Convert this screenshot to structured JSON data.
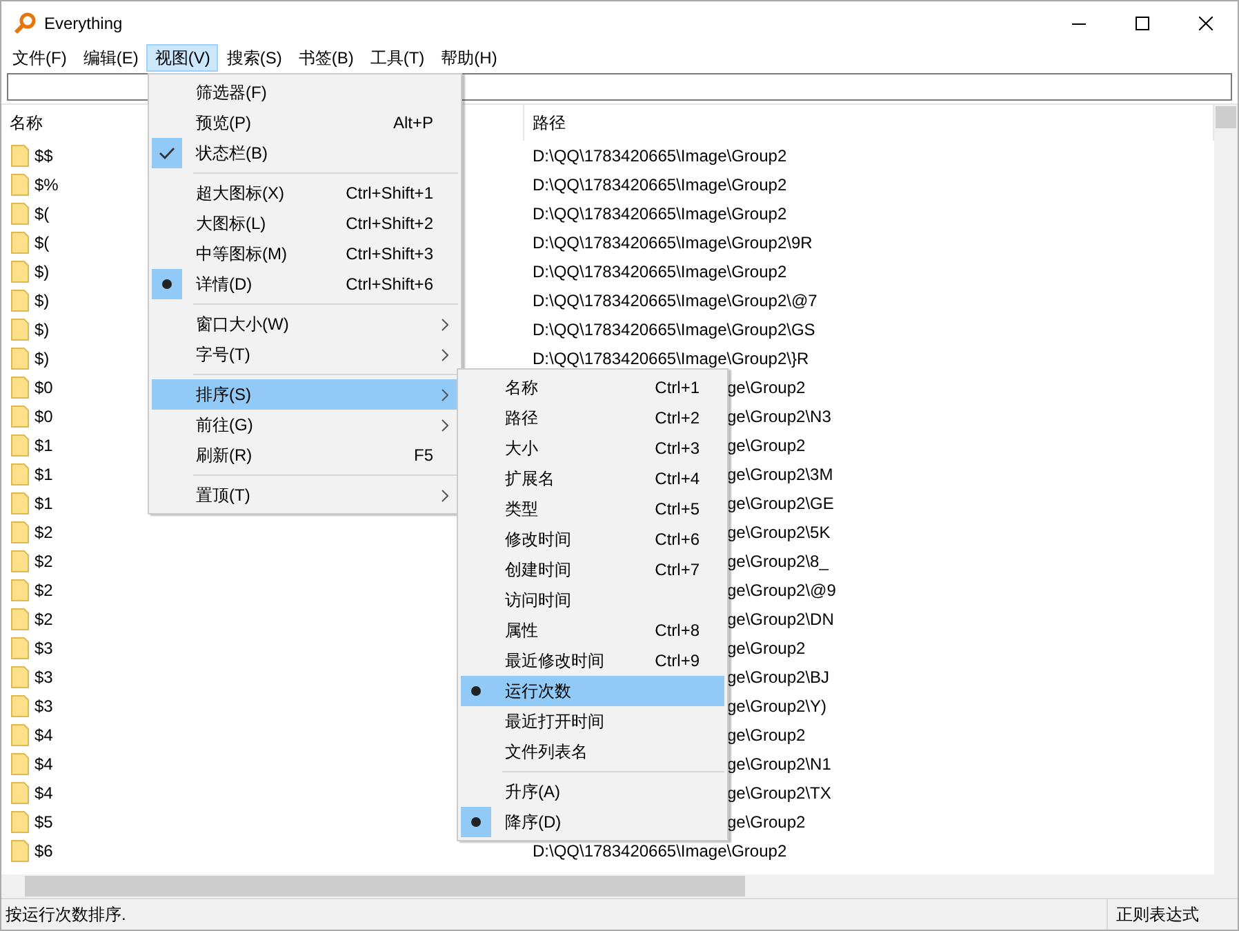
{
  "window": {
    "title": "Everything"
  },
  "menubar": [
    {
      "label": "文件(F)",
      "selected": false
    },
    {
      "label": "编辑(E)",
      "selected": false
    },
    {
      "label": "视图(V)",
      "selected": true
    },
    {
      "label": "搜索(S)",
      "selected": false
    },
    {
      "label": "书签(B)",
      "selected": false
    },
    {
      "label": "工具(T)",
      "selected": false
    },
    {
      "label": "帮助(H)",
      "selected": false
    }
  ],
  "table": {
    "columns": [
      "名称",
      "路径"
    ],
    "rows": [
      {
        "name": "$$",
        "path": "D:\\QQ\\1783420665\\Image\\Group2",
        "kind": "full"
      },
      {
        "name": "$%",
        "path": "D:\\QQ\\1783420665\\Image\\Group2",
        "kind": "full"
      },
      {
        "name": "$(",
        "path": "D:\\QQ\\1783420665\\Image\\Group2",
        "kind": "full"
      },
      {
        "name": "$(",
        "path": "D:\\QQ\\1783420665\\Image\\Group2\\9R",
        "kind": "full"
      },
      {
        "name": "$)",
        "path": "D:\\QQ\\1783420665\\Image\\Group2",
        "kind": "full"
      },
      {
        "name": "$)",
        "path": "D:\\QQ\\1783420665\\Image\\Group2\\@7",
        "kind": "full"
      },
      {
        "name": "$)",
        "path": "D:\\QQ\\1783420665\\Image\\Group2\\GS",
        "kind": "full"
      },
      {
        "name": "$)",
        "path": "D:\\QQ\\1783420665\\Image\\Group2\\}R",
        "kind": "full"
      },
      {
        "name": "$0",
        "path": "ge\\Group2",
        "kind": "clipped"
      },
      {
        "name": "$0",
        "path": "ge\\Group2\\N3",
        "kind": "clipped"
      },
      {
        "name": "$1",
        "path": "ge\\Group2",
        "kind": "clipped"
      },
      {
        "name": "$1",
        "path": "ge\\Group2\\3M",
        "kind": "clipped"
      },
      {
        "name": "$1",
        "path": "ge\\Group2\\GE",
        "kind": "clipped"
      },
      {
        "name": "$2",
        "path": "ge\\Group2\\5K",
        "kind": "clipped"
      },
      {
        "name": "$2",
        "path": "ge\\Group2\\8_",
        "kind": "clipped"
      },
      {
        "name": "$2",
        "path": "ge\\Group2\\@9",
        "kind": "clipped"
      },
      {
        "name": "$2",
        "path": "ge\\Group2\\DN",
        "kind": "clipped"
      },
      {
        "name": "$3",
        "path": "ge\\Group2",
        "kind": "clipped"
      },
      {
        "name": "$3",
        "path": "ge\\Group2\\BJ",
        "kind": "clipped"
      },
      {
        "name": "$3",
        "path": "ge\\Group2\\Y)",
        "kind": "clipped"
      },
      {
        "name": "$4",
        "path": "ge\\Group2",
        "kind": "clipped"
      },
      {
        "name": "$4",
        "path": "ge\\Group2\\N1",
        "kind": "clipped"
      },
      {
        "name": "$4",
        "path": "ge\\Group2\\TX",
        "kind": "clipped"
      },
      {
        "name": "$5",
        "path": "ge\\Group2",
        "kind": "clipped"
      },
      {
        "name": "$6",
        "path": "D:\\QQ\\1783420665\\Image\\Group2",
        "kind": "full"
      }
    ]
  },
  "view_menu": [
    {
      "kind": "plain",
      "label": "筛选器(F)",
      "selected": false
    },
    {
      "kind": "plain",
      "label": "预览(P)",
      "shortcut": "Alt+P",
      "selected": false
    },
    {
      "kind": "check",
      "label": "状态栏(B)",
      "checked": true,
      "selected": false
    },
    {
      "kind": "separator"
    },
    {
      "kind": "radio",
      "label": "超大图标(X)",
      "shortcut": "Ctrl+Shift+1",
      "checked": false,
      "selected": false
    },
    {
      "kind": "radio",
      "label": "大图标(L)",
      "shortcut": "Ctrl+Shift+2",
      "checked": false,
      "selected": false
    },
    {
      "kind": "radio",
      "label": "中等图标(M)",
      "shortcut": "Ctrl+Shift+3",
      "checked": false,
      "selected": false
    },
    {
      "kind": "radio",
      "label": "详情(D)",
      "shortcut": "Ctrl+Shift+6",
      "checked": true,
      "selected": false
    },
    {
      "kind": "separator"
    },
    {
      "kind": "submenu",
      "label": "窗口大小(W)",
      "selected": false
    },
    {
      "kind": "submenu",
      "label": "字号(T)",
      "selected": false
    },
    {
      "kind": "separator"
    },
    {
      "kind": "submenu",
      "label": "排序(S)",
      "selected": true
    },
    {
      "kind": "submenu",
      "label": "前往(G)",
      "selected": false
    },
    {
      "kind": "plain",
      "label": "刷新(R)",
      "shortcut": "F5",
      "selected": false
    },
    {
      "kind": "separator"
    },
    {
      "kind": "submenu",
      "label": "置顶(T)",
      "selected": false
    }
  ],
  "sort_menu": [
    {
      "kind": "radio",
      "label": "名称",
      "shortcut": "Ctrl+1",
      "checked": false,
      "selected": false
    },
    {
      "kind": "radio",
      "label": "路径",
      "shortcut": "Ctrl+2",
      "checked": false,
      "selected": false
    },
    {
      "kind": "radio",
      "label": "大小",
      "shortcut": "Ctrl+3",
      "checked": false,
      "selected": false
    },
    {
      "kind": "radio",
      "label": "扩展名",
      "shortcut": "Ctrl+4",
      "checked": false,
      "selected": false
    },
    {
      "kind": "radio",
      "label": "类型",
      "shortcut": "Ctrl+5",
      "checked": false,
      "selected": false
    },
    {
      "kind": "radio",
      "label": "修改时间",
      "shortcut": "Ctrl+6",
      "checked": false,
      "selected": false
    },
    {
      "kind": "radio",
      "label": "创建时间",
      "shortcut": "Ctrl+7",
      "checked": false,
      "selected": false
    },
    {
      "kind": "radio",
      "label": "访问时间",
      "checked": false,
      "selected": false
    },
    {
      "kind": "radio",
      "label": "属性",
      "shortcut": "Ctrl+8",
      "checked": false,
      "selected": false
    },
    {
      "kind": "radio",
      "label": "最近修改时间",
      "shortcut": "Ctrl+9",
      "checked": false,
      "selected": false
    },
    {
      "kind": "radio",
      "label": "运行次数",
      "checked": true,
      "selected": true
    },
    {
      "kind": "radio",
      "label": "最近打开时间",
      "checked": false,
      "selected": false
    },
    {
      "kind": "radio",
      "label": "文件列表名",
      "checked": false,
      "selected": false
    },
    {
      "kind": "separator"
    },
    {
      "kind": "radio",
      "label": "升序(A)",
      "checked": false,
      "selected": false
    },
    {
      "kind": "radio",
      "label": "降序(D)",
      "checked": true,
      "selected": false
    }
  ],
  "status_bar": {
    "message": "按运行次数排序.",
    "mode": "正则表达式"
  }
}
